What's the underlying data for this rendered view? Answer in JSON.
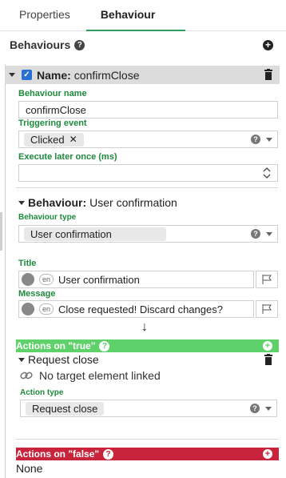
{
  "tabs": [
    {
      "label": "Properties"
    },
    {
      "label": "Behaviour"
    }
  ],
  "behaviours": {
    "title": "Behaviours",
    "help": "?"
  },
  "item": {
    "name_prefix": "Name:",
    "name_value": "confirmClose",
    "behaviour_name_label": "Behaviour name",
    "behaviour_name_value": "confirmClose",
    "triggering_event_label": "Triggering event",
    "triggering_event_value": "Clicked",
    "execute_later_label": "Execute later once (ms)",
    "execute_later_value": "",
    "behaviour_prefix": "Behaviour:",
    "behaviour_value": "User confirmation",
    "behaviour_type_label": "Behaviour type",
    "behaviour_type_value": "User confirmation",
    "title_label": "Title",
    "title_lang": "en",
    "title_value": "User confirmation",
    "message_label": "Message",
    "message_lang": "en",
    "message_value": "Close requested! Discard changes?",
    "arrow": "↓",
    "actions_true_label": "Actions on \"true\"",
    "request_close_title": "Request close",
    "no_target_text": "No target element linked",
    "action_type_label": "Action type",
    "action_type_value": "Request close",
    "actions_false_label": "Actions on \"false\"",
    "none_text": "None"
  },
  "colors": {
    "accent_green": "#2e9e5e",
    "label_green": "#1e8a3c",
    "true_bar": "#5fd16b",
    "false_bar": "#c8243b",
    "checkbox_blue": "#2a6fd6"
  }
}
